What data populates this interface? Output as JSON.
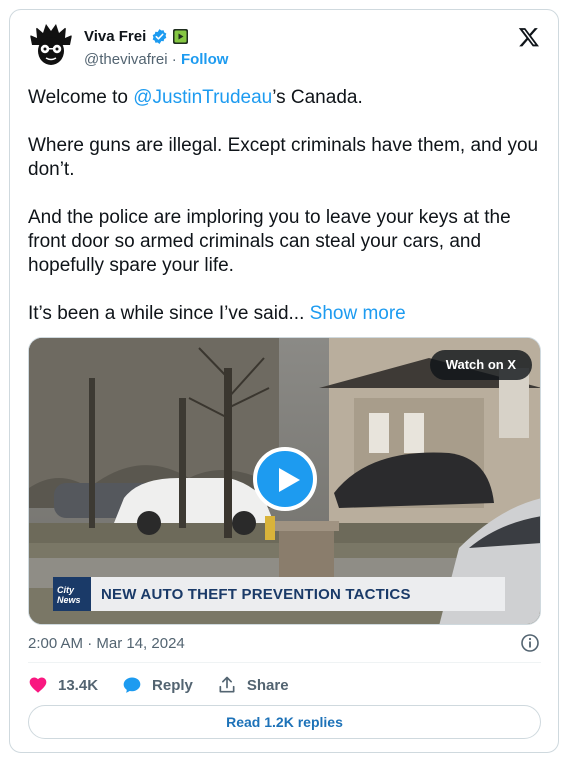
{
  "header": {
    "name": "Viva Frei",
    "handle": "@thevivafrei",
    "separator": " · ",
    "follow_label": "Follow"
  },
  "tweet": {
    "p1_prefix": "Welcome to ",
    "p1_mention": "@JustinTrudeau",
    "p1_suffix": "’s Canada.",
    "p2": "Where guns are illegal. Except criminals have them, and you don’t.",
    "p3": "And the police are imploring you to leave your keys at the front door so armed criminals can steal your cars, and hopefully spare your life.",
    "p4": "It’s been a while since I’ve said... ",
    "show_more": "Show more"
  },
  "media": {
    "watch_label": "Watch on X",
    "news_logo_line1": "City",
    "news_logo_line2": "News",
    "headline": "NEW AUTO THEFT PREVENTION TACTICS"
  },
  "footer": {
    "timestamp": "2:00 AM · Mar 14, 2024",
    "likes": "13.4K",
    "reply_label": "Reply",
    "share_label": "Share",
    "read_replies": "Read 1.2K replies"
  },
  "colors": {
    "accent": "#1d9bf0",
    "like": "#f91880",
    "text_secondary": "#536471"
  },
  "icons": [
    "verified-badge-icon",
    "rumble-icon",
    "x-logo-icon",
    "play-icon",
    "info-icon",
    "heart-icon",
    "reply-bubble-icon",
    "share-icon"
  ]
}
